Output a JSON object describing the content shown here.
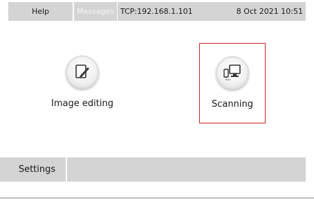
{
  "topbar": {
    "help_label": "Help",
    "messages_label": "Messages",
    "connection": "TCP:192.168.1.101",
    "datetime": "8 Oct 2021  10:51"
  },
  "tiles": [
    {
      "label": "Image editing",
      "icon": "image-edit-icon"
    },
    {
      "label": "Scanning",
      "icon": "scanning-icon"
    }
  ],
  "bottombar": {
    "settings_label": "Settings"
  },
  "colors": {
    "bar_gray": "#d4d4d4",
    "highlight_red": "#d0202a"
  }
}
